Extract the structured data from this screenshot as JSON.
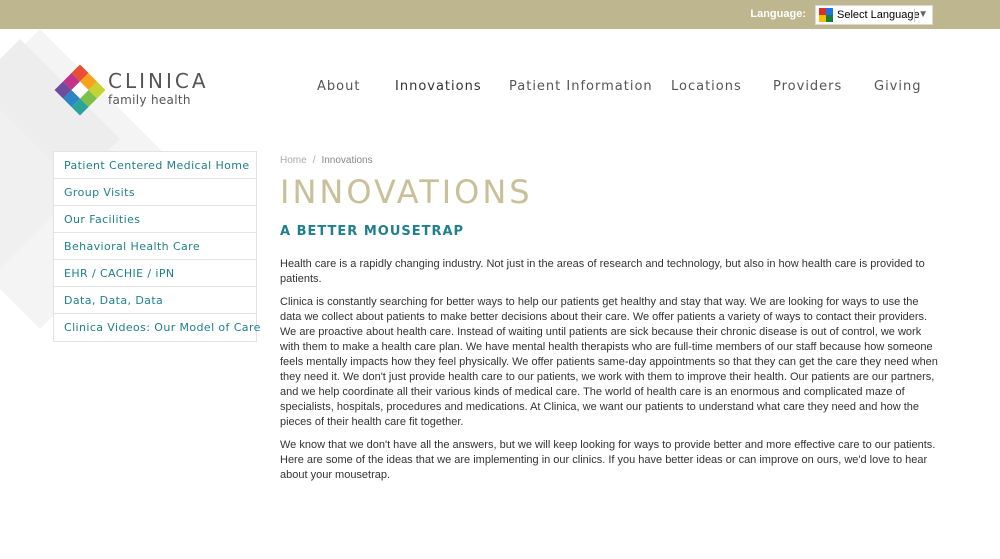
{
  "language": {
    "label": "Language:",
    "select_text": "Select Language",
    "arrow": "▼"
  },
  "logo": {
    "word": "CLINICA",
    "sub": "family health"
  },
  "nav": [
    {
      "label": "About"
    },
    {
      "label": "Innovations"
    },
    {
      "label": "Patient Information"
    },
    {
      "label": "Locations"
    },
    {
      "label": "Providers"
    },
    {
      "label": "Giving"
    }
  ],
  "sidebar": {
    "items": [
      {
        "label": "Patient Centered Medical Home"
      },
      {
        "label": "Group Visits"
      },
      {
        "label": "Our Facilities"
      },
      {
        "label": "Behavioral Health Care"
      },
      {
        "label": "EHR / CACHIE / iPN"
      },
      {
        "label": "Data, Data, Data"
      },
      {
        "label": "Clinica Videos: Our Model of Care"
      }
    ]
  },
  "breadcrumb": {
    "home": "Home",
    "separator": "/",
    "current": "Innovations"
  },
  "main": {
    "title": "INNOVATIONS",
    "subtitle": "A BETTER MOUSETRAP",
    "paragraphs": [
      "Health care is a rapidly changing industry. Not just in the areas of research and technology, but also in how health care is provided to patients.",
      "Clinica is constantly searching for better ways to help our patients get healthy and stay that way. We are looking for ways to use the data we collect about patients to make better decisions about their care. We offer patients a variety of ways to contact their providers. We are proactive about health care. Instead of waiting until patients are sick because their chronic disease is out of control, we work with them to make a health care plan. We have mental health therapists who are full-time members of our staff because how someone feels mentally impacts how they feel physically. We offer patients same-day appointments so that they can get the care they need when they need it. We don't just provide health care to our patients, we work with them to improve their health. Our patients are our partners, and we help coordinate all their various kinds of medical care. The world of health care is an enormous and complicated maze of specialists, hospitals, procedures and medications. At Clinica, we want our patients to understand what care they need and how the pieces of their health care fit together.",
      "We know that we don't have all the answers, but we will keep looking for ways to provide better and more effective care to our patients. Here are some of the ideas that we are implementing in our clinics. If you have better ideas or can improve on ours, we'd love to hear about your mousetrap."
    ]
  },
  "colors": {
    "topbar": "#beb68f",
    "accent_teal": "#1f7f8c",
    "title_gold": "#c9bf99"
  }
}
